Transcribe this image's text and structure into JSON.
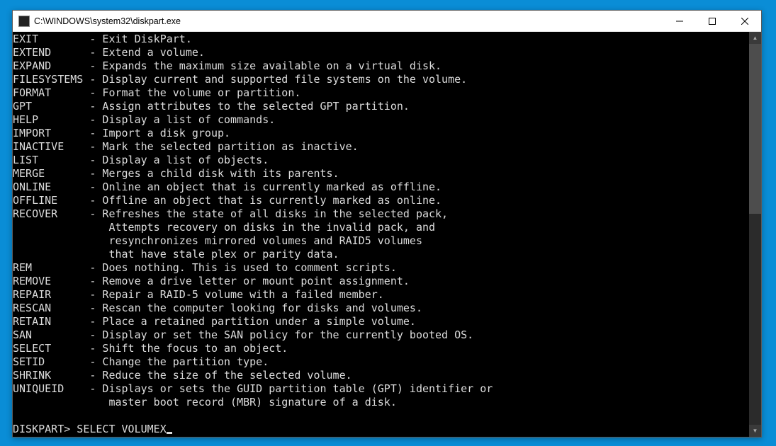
{
  "window": {
    "title": "C:\\WINDOWS\\system32\\diskpart.exe"
  },
  "commands": [
    {
      "name": "EXIT",
      "desc": "Exit DiskPart."
    },
    {
      "name": "EXTEND",
      "desc": "Extend a volume."
    },
    {
      "name": "EXPAND",
      "desc": "Expands the maximum size available on a virtual disk."
    },
    {
      "name": "FILESYSTEMS",
      "desc": "Display current and supported file systems on the volume."
    },
    {
      "name": "FORMAT",
      "desc": "Format the volume or partition."
    },
    {
      "name": "GPT",
      "desc": "Assign attributes to the selected GPT partition."
    },
    {
      "name": "HELP",
      "desc": "Display a list of commands."
    },
    {
      "name": "IMPORT",
      "desc": "Import a disk group."
    },
    {
      "name": "INACTIVE",
      "desc": "Mark the selected partition as inactive."
    },
    {
      "name": "LIST",
      "desc": "Display a list of objects."
    },
    {
      "name": "MERGE",
      "desc": "Merges a child disk with its parents."
    },
    {
      "name": "ONLINE",
      "desc": "Online an object that is currently marked as offline."
    },
    {
      "name": "OFFLINE",
      "desc": "Offline an object that is currently marked as online."
    },
    {
      "name": "RECOVER",
      "desc": "Refreshes the state of all disks in the selected pack,"
    },
    {
      "name": "",
      "desc": "Attempts recovery on disks in the invalid pack, and"
    },
    {
      "name": "",
      "desc": "resynchronizes mirrored volumes and RAID5 volumes"
    },
    {
      "name": "",
      "desc": "that have stale plex or parity data."
    },
    {
      "name": "REM",
      "desc": "Does nothing. This is used to comment scripts."
    },
    {
      "name": "REMOVE",
      "desc": "Remove a drive letter or mount point assignment."
    },
    {
      "name": "REPAIR",
      "desc": "Repair a RAID-5 volume with a failed member."
    },
    {
      "name": "RESCAN",
      "desc": "Rescan the computer looking for disks and volumes."
    },
    {
      "name": "RETAIN",
      "desc": "Place a retained partition under a simple volume."
    },
    {
      "name": "SAN",
      "desc": "Display or set the SAN policy for the currently booted OS."
    },
    {
      "name": "SELECT",
      "desc": "Shift the focus to an object."
    },
    {
      "name": "SETID",
      "desc": "Change the partition type."
    },
    {
      "name": "SHRINK",
      "desc": "Reduce the size of the selected volume."
    },
    {
      "name": "UNIQUEID",
      "desc": "Displays or sets the GUID partition table (GPT) identifier or"
    },
    {
      "name": "",
      "desc": "master boot record (MBR) signature of a disk."
    }
  ],
  "prompt": {
    "label": "DISKPART>",
    "input": "SELECT VOLUMEX"
  }
}
